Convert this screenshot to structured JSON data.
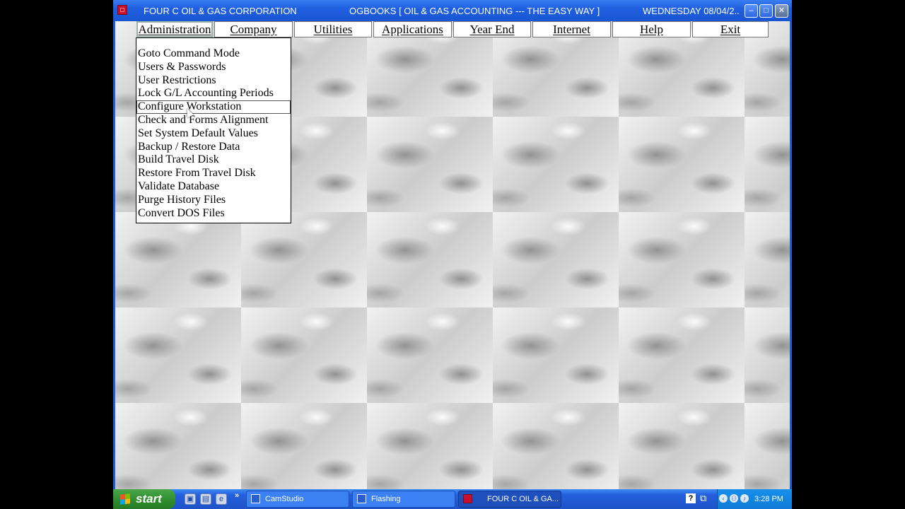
{
  "window": {
    "company": "FOUR C OIL & GAS CORPORATION",
    "app_title": "OGBOOKS [ OIL & GAS ACCOUNTING --- THE EASY WAY ]",
    "date": "WEDNESDAY 08/04/2...",
    "min_glyph": "–",
    "max_glyph": "□",
    "close_glyph": "✕"
  },
  "menu": [
    {
      "label": "Administration",
      "active": true
    },
    {
      "label": "Company"
    },
    {
      "label": "Utilities"
    },
    {
      "label": "Applications"
    },
    {
      "label": "Year End"
    },
    {
      "label": "Internet"
    },
    {
      "label": "Help"
    },
    {
      "label": "Exit"
    }
  ],
  "dropdown": {
    "items": [
      "Goto Command Mode",
      "Users & Passwords",
      "User Restrictions",
      "Lock G/L Accounting Periods",
      "Configure Workstation",
      "Check and Forms Alignment",
      "Set System Default Values",
      "Backup / Restore Data",
      "Build Travel Disk",
      "Restore From Travel Disk",
      "Validate Database",
      "Purge History Files",
      "Convert DOS Files"
    ],
    "hovered": "Configure Workstation"
  },
  "taskbar": {
    "start_label": "start",
    "quicklaunch": [
      {
        "icon": "desktop-icon",
        "glyph": "▣"
      },
      {
        "icon": "show-desktop-icon",
        "glyph": "▤"
      },
      {
        "icon": "internet-explorer-icon",
        "glyph": "e"
      }
    ],
    "more": "»",
    "tasks": [
      {
        "label": "CamStudio",
        "icon": "camstudio-icon",
        "active": false
      },
      {
        "label": "Flashing",
        "icon": "flashing-icon",
        "active": false
      },
      {
        "label": "FOUR C OIL & GA...",
        "icon": "ogbooks-icon",
        "active": true
      }
    ],
    "help_glyph": "?",
    "screen_glyph": "⧉",
    "tray_icons": [
      {
        "icon": "back-arrow-icon",
        "glyph": "‹"
      },
      {
        "icon": "network-icon",
        "glyph": "⚇"
      },
      {
        "icon": "sound-icon",
        "glyph": "♪"
      }
    ],
    "clock": "3:28 PM"
  }
}
